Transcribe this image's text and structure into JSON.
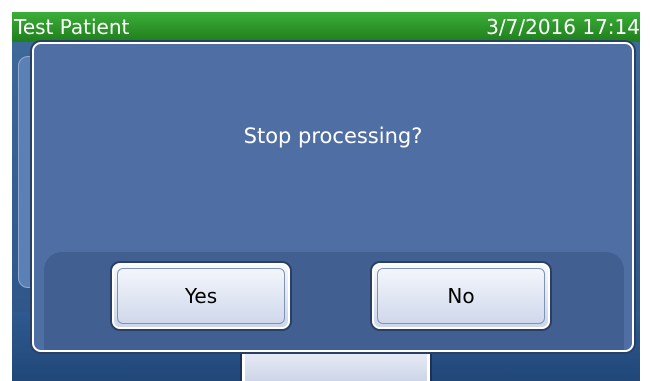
{
  "header": {
    "patient_name": "Test Patient",
    "datetime": "3/7/2016 17:14"
  },
  "dialog": {
    "message": "Stop processing?",
    "yes_label": "Yes",
    "no_label": "No"
  },
  "colors": {
    "header_green": "#2a9428",
    "screen_blue": "#3f6a9c",
    "dialog_blue": "#4e6ea4",
    "button_face": "#e3e8f4"
  }
}
